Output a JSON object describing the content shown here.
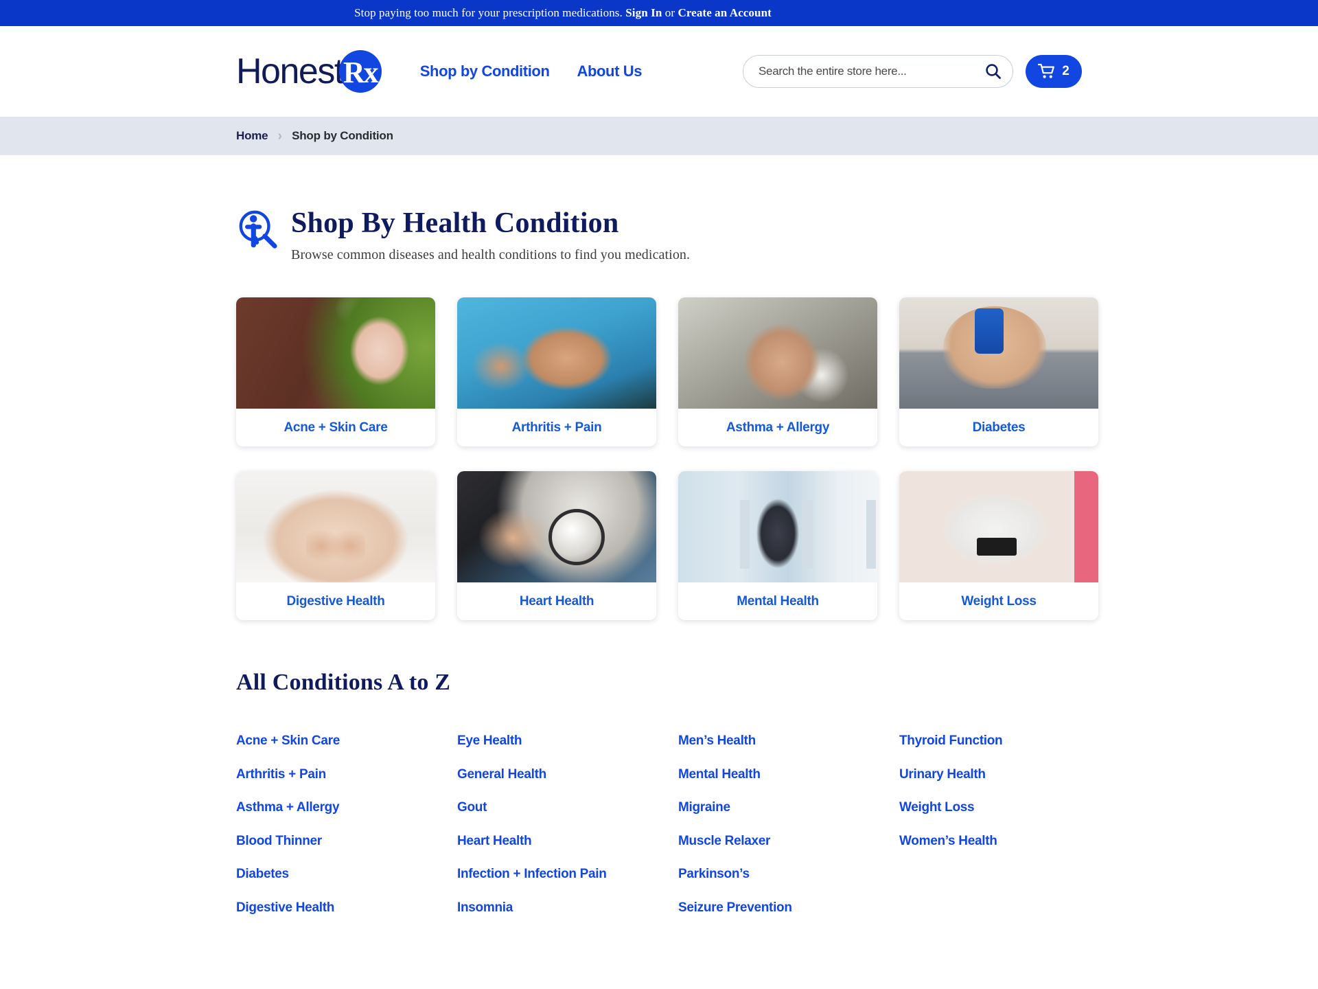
{
  "announcement": {
    "text_before": "Stop paying too much for your prescription medications.",
    "sign_in": "Sign In",
    "or": "or",
    "create_account": "Create an Account"
  },
  "header": {
    "logo_word": "Honest",
    "logo_badge": "Rx",
    "nav": [
      {
        "label": "Shop by Condition"
      },
      {
        "label": "About Us"
      }
    ],
    "search": {
      "placeholder": "Search the entire store here...",
      "value": "",
      "icon": "search-icon"
    },
    "cart": {
      "icon": "shopping-cart-icon",
      "count": "2"
    }
  },
  "breadcrumb": {
    "home": "Home",
    "separator": "›",
    "current": "Shop by Condition"
  },
  "page": {
    "icon": "person-magnifier-icon",
    "title": "Shop By Health Condition",
    "subtitle": "Browse common diseases and health conditions to find you medication."
  },
  "cards": [
    {
      "label": "Acne + Skin Care",
      "photo": "ph-acne",
      "alt": "woman-with-face-mask-and-avocado"
    },
    {
      "label": "Arthritis + Pain",
      "photo": "ph-arthritis",
      "alt": "hands-holding-painful-joint"
    },
    {
      "label": "Asthma + Allergy",
      "photo": "ph-asthma",
      "alt": "man-blowing-nose-with-tissue"
    },
    {
      "label": "Diabetes",
      "photo": "ph-diabetes",
      "alt": "hands-using-glucose-meter"
    },
    {
      "label": "Digestive Health",
      "photo": "ph-digestive",
      "alt": "hands-forming-heart-over-stomach"
    },
    {
      "label": "Heart Health",
      "photo": "ph-heart",
      "alt": "blood-pressure-cuff-measurement"
    },
    {
      "label": "Mental Health",
      "photo": "ph-mental",
      "alt": "person-sitting-alone-by-window"
    },
    {
      "label": "Weight Loss",
      "photo": "ph-weight",
      "alt": "feet-standing-on-bathroom-scale"
    }
  ],
  "atoz": {
    "heading": "All Conditions A to Z",
    "columns": [
      [
        {
          "label": "Acne + Skin Care"
        },
        {
          "label": "Arthritis + Pain"
        },
        {
          "label": "Asthma + Allergy"
        },
        {
          "label": "Blood Thinner"
        },
        {
          "label": "Diabetes"
        },
        {
          "label": "Digestive Health"
        }
      ],
      [
        {
          "label": "Eye Health"
        },
        {
          "label": "General Health"
        },
        {
          "label": "Gout"
        },
        {
          "label": "Heart Health"
        },
        {
          "label": "Infection + Infection Pain"
        },
        {
          "label": "Insomnia"
        }
      ],
      [
        {
          "label": "Men’s Health"
        },
        {
          "label": "Mental Health"
        },
        {
          "label": "Migraine"
        },
        {
          "label": "Muscle Relaxer"
        },
        {
          "label": "Parkinson’s"
        },
        {
          "label": "Seizure Prevention"
        }
      ],
      [
        {
          "label": "Thyroid Function"
        },
        {
          "label": "Urinary Health"
        },
        {
          "label": "Weight Loss"
        },
        {
          "label": "Women’s Health"
        }
      ]
    ]
  },
  "colors": {
    "brand_blue": "#1246e0",
    "announce_blue": "#0b37c9",
    "navy": "#101a5e",
    "link_blue": "#1559d6",
    "breadcrumb_bg": "#e1e5ee"
  }
}
